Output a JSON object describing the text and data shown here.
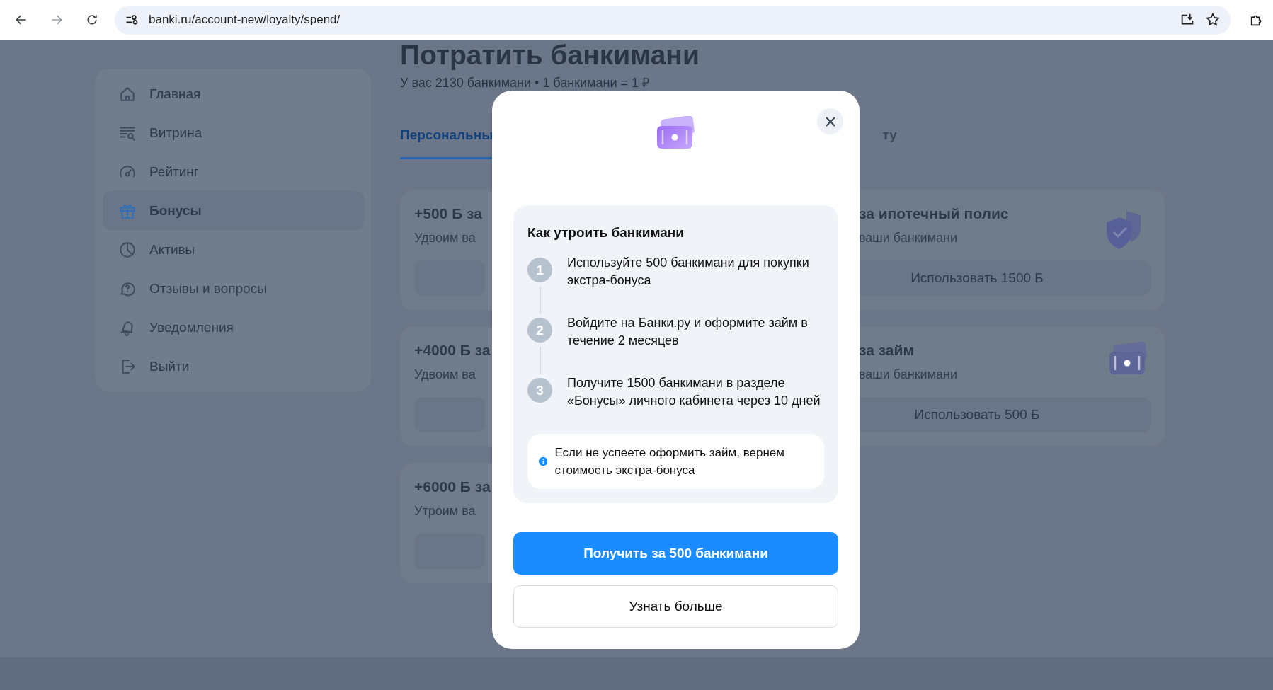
{
  "browser": {
    "url": "banki.ru/account-new/loyalty/spend/"
  },
  "sidebar": {
    "items": [
      {
        "label": "Главная",
        "selected": false
      },
      {
        "label": "Витрина",
        "selected": false
      },
      {
        "label": "Рейтинг",
        "selected": false
      },
      {
        "label": "Бонусы",
        "selected": true
      },
      {
        "label": "Активы",
        "selected": false
      },
      {
        "label": "Отзывы и вопросы",
        "selected": false
      },
      {
        "label": "Уведомления",
        "selected": false
      },
      {
        "label": "Выйти",
        "selected": false
      }
    ]
  },
  "page": {
    "title": "Потратить банкимани",
    "subtitle": "У вас 2130 банкимани • 1 банкимани = 1 ₽"
  },
  "tabs": [
    {
      "label": "Персональны",
      "selected": true
    },
    {
      "label": "ту",
      "selected": false
    }
  ],
  "offer_rows": [
    {
      "left": {
        "title": "+500 Б за",
        "description": "Удвоим ва"
      },
      "right": {
        "title": "за ипотечный полис",
        "description": "ваши банкимани",
        "button": "Использовать 1500 Б",
        "kind": "shield"
      }
    },
    {
      "left": {
        "title": "+4000 Б за",
        "description": "Удвоим ва"
      },
      "right": {
        "title": "за займ",
        "description": "ваши банкимани",
        "button": "Использовать 500 Б",
        "kind": "wallet"
      }
    },
    {
      "left": {
        "title": "+6000 Б за",
        "description": "Утроим ва"
      }
    }
  ],
  "modal": {
    "title": "Как утроить банкимани",
    "steps": [
      {
        "number": "1",
        "text": "Используйте 500 банкимани для покупки экстра-бонуса"
      },
      {
        "number": "2",
        "text": "Войдите на Банки.ру и оформите займ в течение 2 месяцев"
      },
      {
        "number": "3",
        "text": "Получите 1500 банкимани в разделе «Бонусы» личного кабинета через 10 дней"
      }
    ],
    "note": "Если не успеете оформить займ, вернем стоимость экстра-бонуса",
    "primary_button": "Получить за 500 банкимани",
    "secondary_button": "Узнать больше"
  }
}
